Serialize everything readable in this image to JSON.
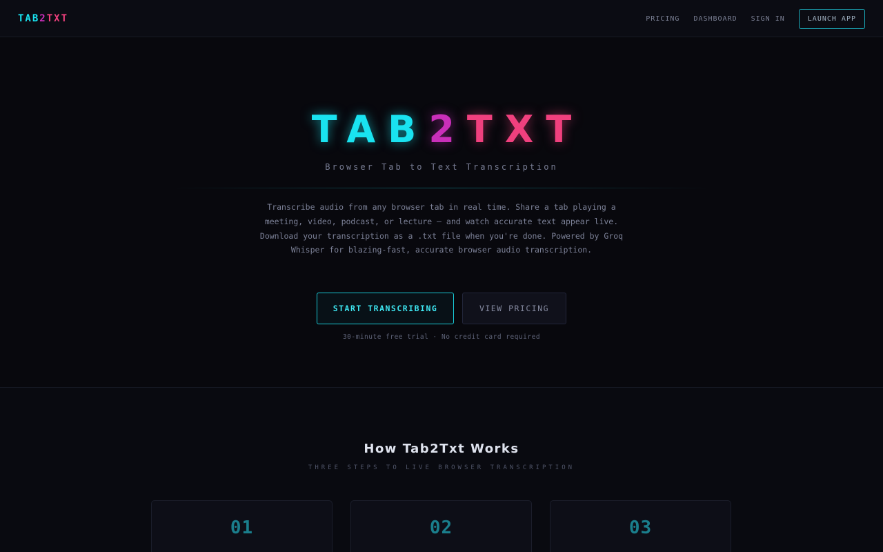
{
  "nav": {
    "logo": {
      "part1": "TAB",
      "part2": "2",
      "part3": "TXT"
    },
    "links": [
      "PRICING",
      "DASHBOARD",
      "SIGN IN"
    ],
    "cta": "LAUNCH APP"
  },
  "hero": {
    "title": {
      "part1": "TAB",
      "part2": "2",
      "part3": "TXT"
    },
    "subtitle": "Browser Tab to Text Transcription",
    "description": "Transcribe audio from any browser tab in real time. Share a tab playing a meeting, video, podcast, or lecture — and watch accurate text appear live. Download your transcription as a .txt file when you're done. Powered by Groq Whisper for blazing-fast, accurate browser audio transcription.",
    "primary_button": "START TRANSCRIBING",
    "secondary_button": "VIEW PRICING",
    "note": "30-minute free trial · No credit card required"
  },
  "how": {
    "title": "How Tab2Txt Works",
    "subtitle": "THREE STEPS TO LIVE BROWSER TRANSCRIPTION",
    "steps": [
      {
        "number": "01"
      },
      {
        "number": "02"
      },
      {
        "number": "03"
      }
    ]
  },
  "colors": {
    "background": "#08080d",
    "cyan": "#19e3f0",
    "magenta": "#c92fb9",
    "pink": "#f0407e"
  }
}
